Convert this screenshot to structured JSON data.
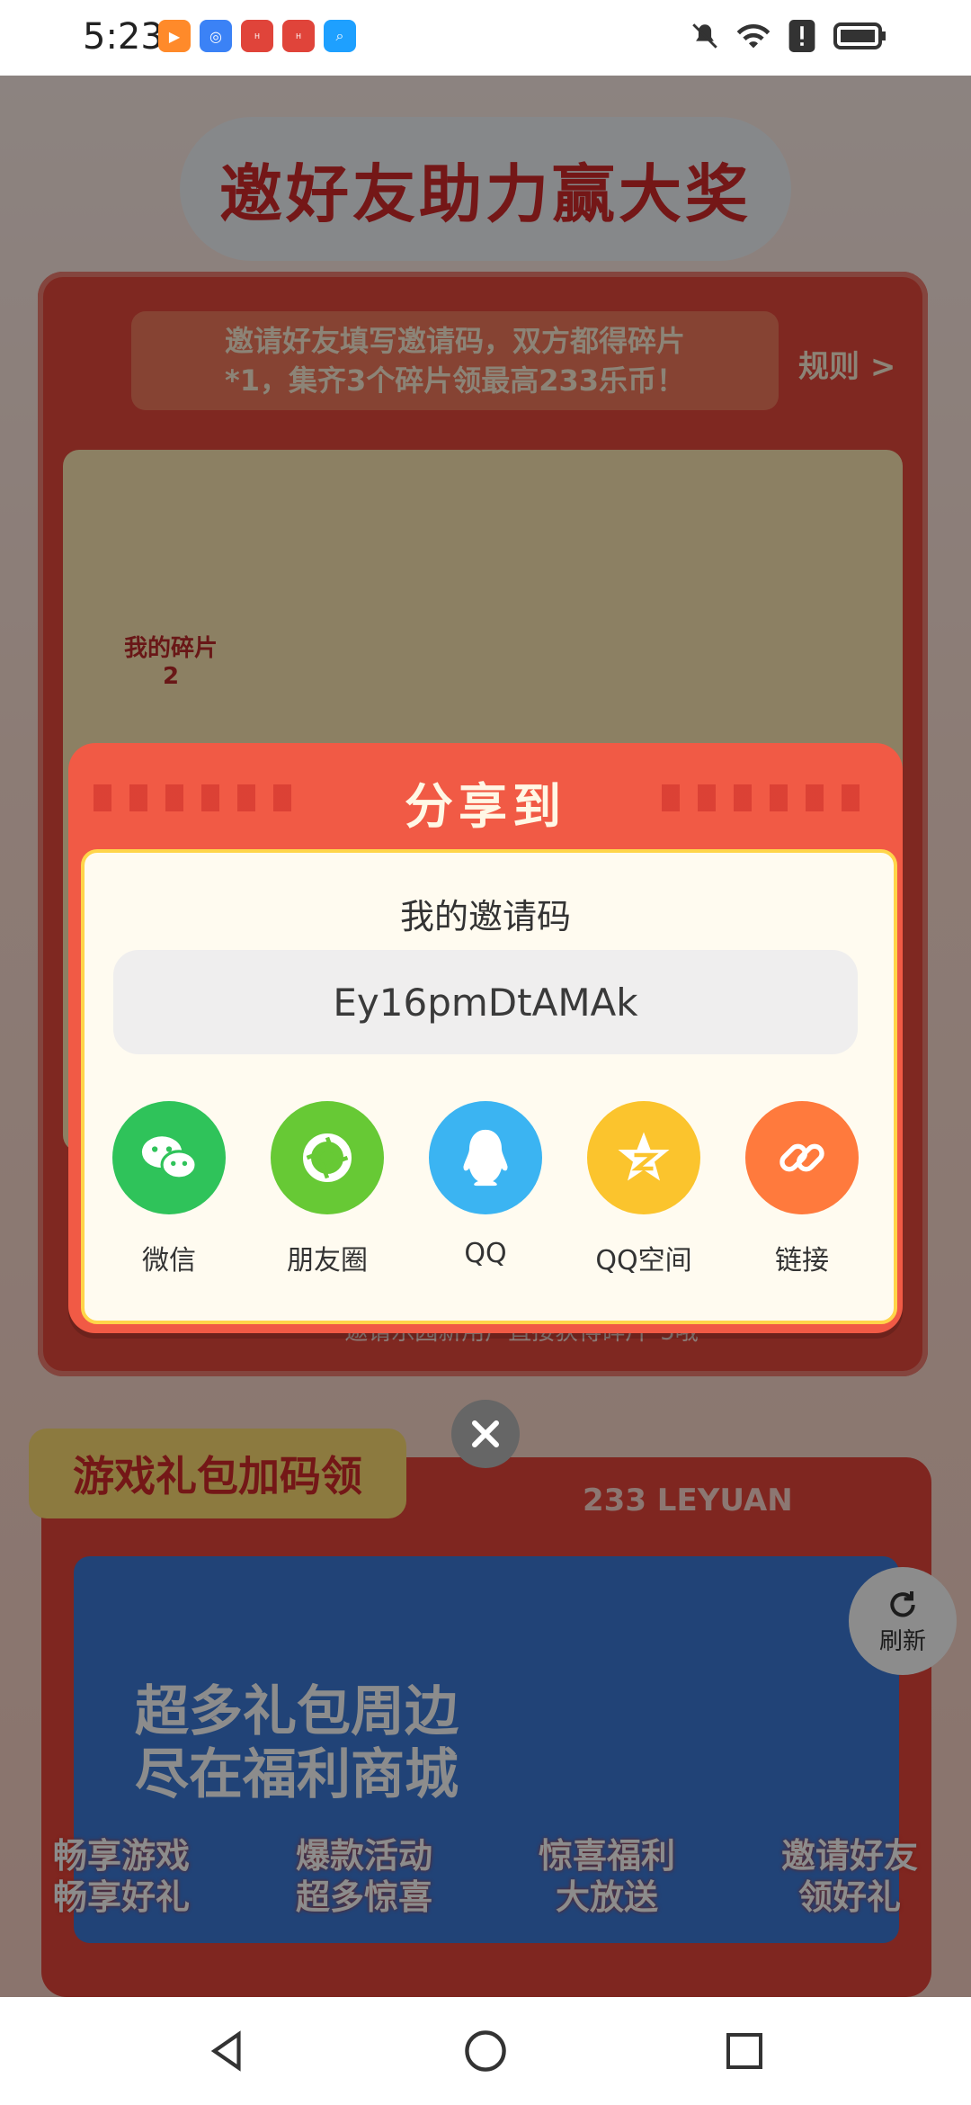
{
  "status_bar": {
    "time": "5:23",
    "apps": [
      {
        "name": "play-app-icon",
        "color": "#ff8a2a",
        "glyph": "▶"
      },
      {
        "name": "browser-app-icon",
        "color": "#3b82f6",
        "glyph": "◎"
      },
      {
        "name": "huawei-app-icon-1",
        "color": "#e0443a",
        "glyph": "HUAWEI"
      },
      {
        "name": "huawei-app-icon-2",
        "color": "#e0443a",
        "glyph": "HUAWEI"
      },
      {
        "name": "search-app-icon",
        "color": "#1ea0ff",
        "glyph": "⌕"
      }
    ]
  },
  "background": {
    "page_title": "邀好友助力赢大奖",
    "invite_line1": "邀请好友填写邀请码，双方都得碎片",
    "invite_line2": "*1，集齐3个碎片领最高233乐币！",
    "rules": "规则 >",
    "my_fragments_label": "我的碎片",
    "my_fragments_count": "2",
    "bottom_hint": "邀请乐园新用户直接获得碎片*5哦",
    "gift_tag": "游戏礼包加码领",
    "leyuan": "233 LEYUAN",
    "banner_title_line1": "超多礼包周边",
    "banner_title_line2": "尽在福利商城",
    "refresh": "刷新",
    "tabs": [
      {
        "line1": "畅享游戏",
        "line2": "畅享好礼"
      },
      {
        "line1": "爆款活动",
        "line2": "超多惊喜"
      },
      {
        "line1": "惊喜福利",
        "line2": "大放送"
      },
      {
        "line1": "邀请好友",
        "line2": "领好礼"
      }
    ]
  },
  "share_modal": {
    "title": "分享到",
    "code_label": "我的邀请码",
    "code": "Ey16pmDtAMAk",
    "options": [
      {
        "label": "微信",
        "icon": "wechat-icon",
        "color": "#2fc35a"
      },
      {
        "label": "朋友圈",
        "icon": "moments-icon",
        "color": "#67c935"
      },
      {
        "label": "QQ",
        "icon": "qq-icon",
        "color": "#3bb4f2"
      },
      {
        "label": "QQ空间",
        "icon": "qzone-icon",
        "color": "#fbc42d"
      },
      {
        "label": "链接",
        "icon": "link-icon",
        "color": "#ff7a3d"
      }
    ]
  },
  "accent_colors": {
    "modal_red": "#f15a45",
    "panel_cream": "#fffbf0",
    "border_yellow": "#ffd54a"
  }
}
